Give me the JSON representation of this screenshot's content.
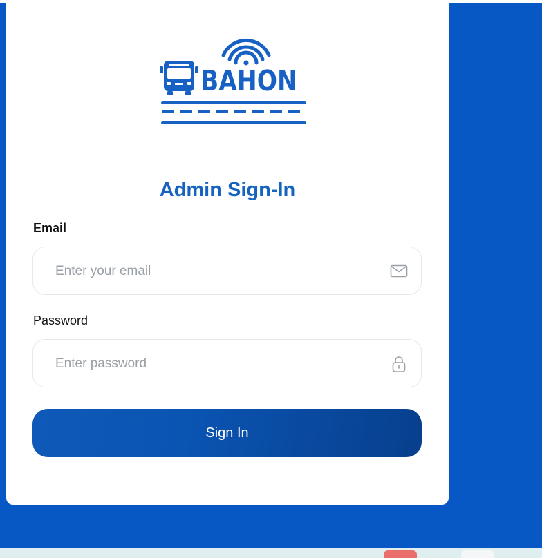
{
  "brand": {
    "name": "BAHON",
    "color": "#1761c5"
  },
  "page": {
    "title": "Admin Sign-In",
    "background_color": "#0758c4"
  },
  "form": {
    "email_label": "Email",
    "email_placeholder": "Enter your email",
    "email_icon": "mail-icon",
    "password_label": "Password",
    "password_placeholder": "Enter password",
    "password_icon": "lock-icon",
    "submit_label": "Sign In"
  }
}
